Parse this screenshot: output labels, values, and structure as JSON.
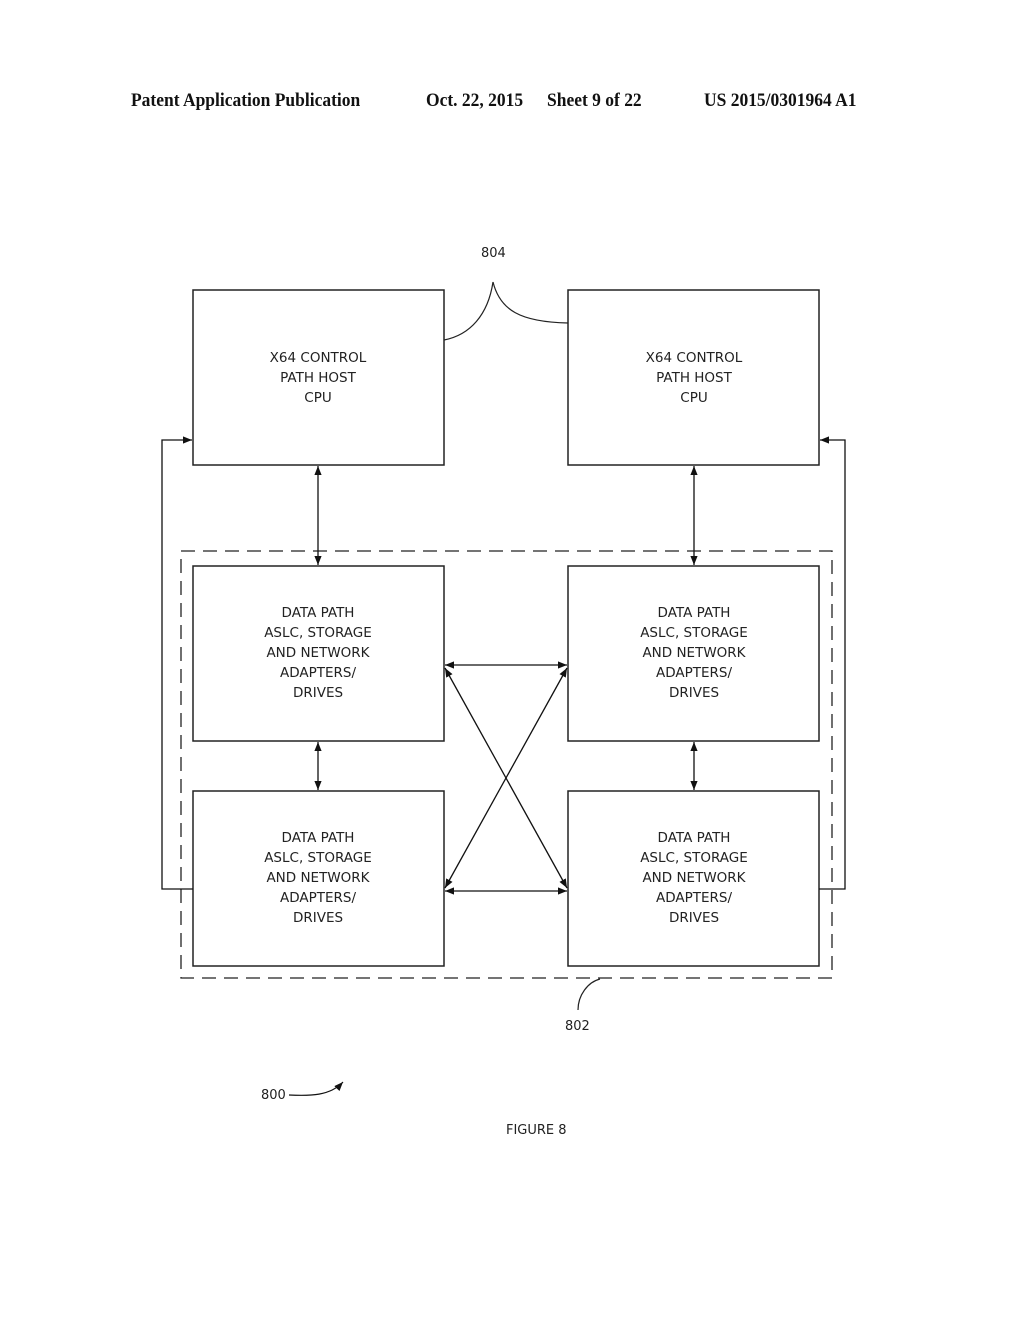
{
  "header": {
    "publication": "Patent Application Publication",
    "date": "Oct. 22, 2015",
    "sheet": "Sheet 9 of 22",
    "number": "US 2015/0301964 A1"
  },
  "diagram": {
    "control_boxes": [
      {
        "lines": [
          "X64 CONTROL",
          "PATH HOST",
          "CPU"
        ]
      },
      {
        "lines": [
          "X64 CONTROL",
          "PATH HOST",
          "CPU"
        ]
      }
    ],
    "data_boxes": [
      {
        "lines": [
          "DATA PATH",
          "ASLC, STORAGE",
          "AND NETWORK",
          "ADAPTERS/",
          "DRIVES"
        ]
      },
      {
        "lines": [
          "DATA PATH",
          "ASLC, STORAGE",
          "AND NETWORK",
          "ADAPTERS/",
          "DRIVES"
        ]
      },
      {
        "lines": [
          "DATA PATH",
          "ASLC, STORAGE",
          "AND NETWORK",
          "ADAPTERS/",
          "DRIVES"
        ]
      },
      {
        "lines": [
          "DATA PATH",
          "ASLC, STORAGE",
          "AND NETWORK",
          "ADAPTERS/",
          "DRIVES"
        ]
      }
    ],
    "ref_control": "804",
    "ref_data_group": "802",
    "ref_figure": "800",
    "caption": "FIGURE 8"
  }
}
